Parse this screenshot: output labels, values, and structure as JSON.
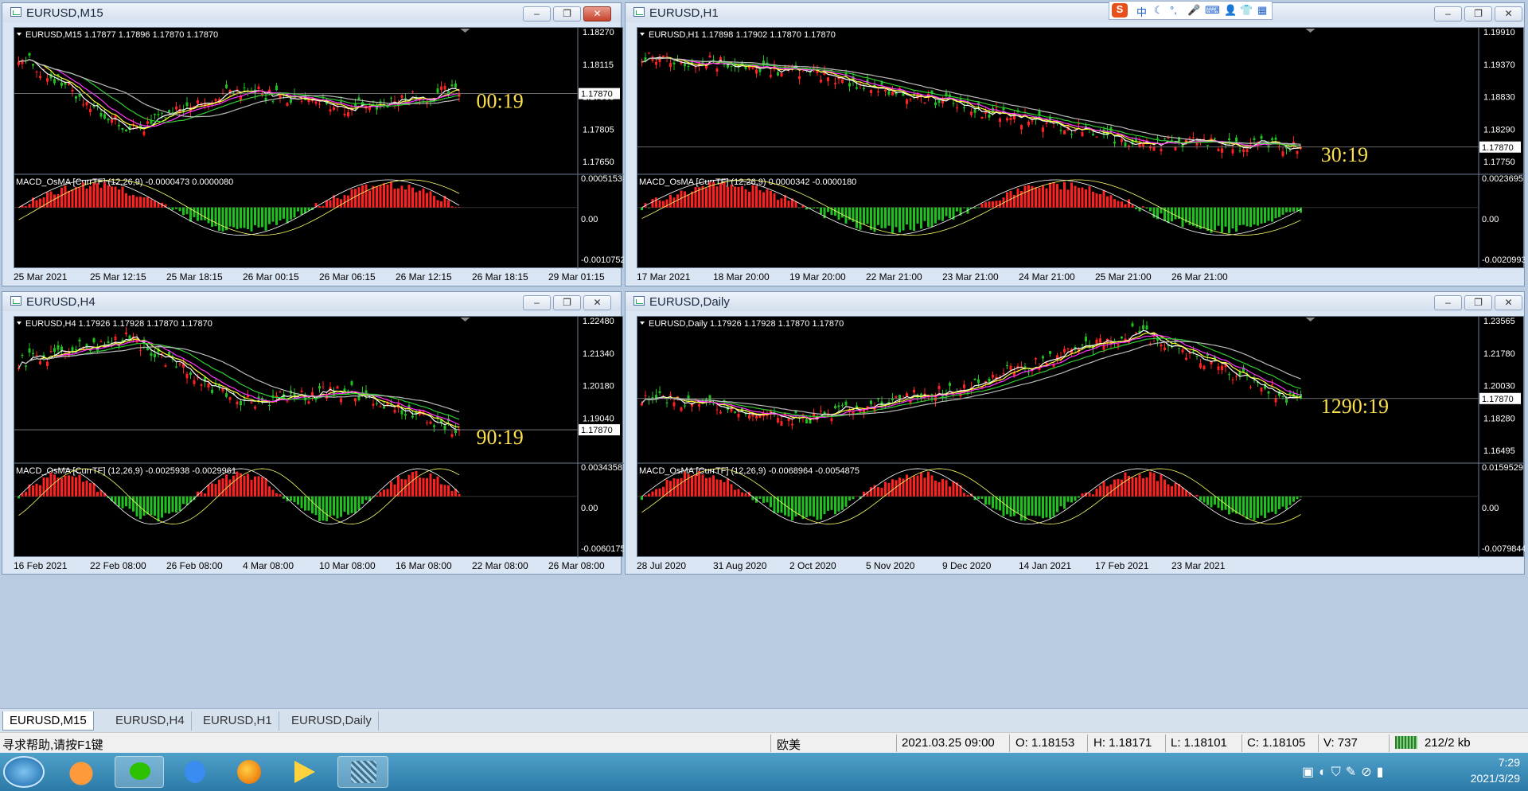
{
  "windows": [
    {
      "title": "EURUSD,M15",
      "header": "EURUSD,M15  1.17877 1.17896 1.17870 1.17870",
      "prices": [
        "1.18270",
        "1.18115",
        "1.17960",
        "1.17805",
        "1.17650"
      ],
      "current": "1.17870",
      "timer": "00:19",
      "macd": "MACD_OsMA [CurrTF] (12,26,9) -0.0000473 0.0000080",
      "macd_scale": [
        "0.0005153",
        "0.00",
        "-0.0010752"
      ],
      "xlabels": [
        "25 Mar 2021",
        "25 Mar 12:15",
        "25 Mar 18:15",
        "26 Mar 00:15",
        "26 Mar 06:15",
        "26 Mar 12:15",
        "26 Mar 18:15",
        "29 Mar 01:15"
      ]
    },
    {
      "title": "EURUSD,H1",
      "header": "EURUSD,H1  1.17898 1.17902 1.17870 1.17870",
      "prices": [
        "1.19910",
        "1.19370",
        "1.18830",
        "1.18290",
        "1.17750"
      ],
      "current": "1.17870",
      "timer": "30:19",
      "macd": "MACD_OsMA [CurrTF] (12,26,9) 0.0000342 -0.0000180",
      "macd_scale": [
        "0.0023695",
        "0.00",
        "-0.0020993"
      ],
      "xlabels": [
        "17 Mar 2021",
        "18 Mar 20:00",
        "19 Mar 20:00",
        "22 Mar 21:00",
        "23 Mar 21:00",
        "24 Mar 21:00",
        "25 Mar 21:00",
        "26 Mar 21:00"
      ]
    },
    {
      "title": "EURUSD,H4",
      "header": "EURUSD,H4  1.17926 1.17928 1.17870 1.17870",
      "prices": [
        "1.22480",
        "1.21340",
        "1.20180",
        "1.19040",
        ""
      ],
      "current": "1.17870",
      "timer": "90:19",
      "macd": "MACD_OsMA [CurrTF] (12,26,9) -0.0025938 -0.0029961",
      "macd_scale": [
        "0.0034358",
        "0.00",
        "-0.0060175"
      ],
      "xlabels": [
        "16 Feb 2021",
        "22 Feb 08:00",
        "26 Feb 08:00",
        "4 Mar 08:00",
        "10 Mar 08:00",
        "16 Mar 08:00",
        "22 Mar 08:00",
        "26 Mar 08:00"
      ]
    },
    {
      "title": "EURUSD,Daily",
      "header": "EURUSD,Daily  1.17926 1.17928 1.17870 1.17870",
      "prices": [
        "1.23565",
        "1.21780",
        "1.20030",
        "1.18280",
        "1.16495"
      ],
      "current": "1.17870",
      "timer": "1290:19",
      "macd": "MACD_OsMA [CurrTF] (12,26,9) -0.0068964 -0.0054875",
      "macd_scale": [
        "0.0159529",
        "0.00",
        "-0.0079844"
      ],
      "xlabels": [
        "28 Jul 2020",
        "31 Aug 2020",
        "2 Oct 2020",
        "5 Nov 2020",
        "9 Dec 2020",
        "14 Jan 2021",
        "17 Feb 2021",
        "23 Mar 2021"
      ]
    }
  ],
  "tabs": [
    "EURUSD,M15",
    "EURUSD,H4",
    "EURUSD,H1",
    "EURUSD,Daily"
  ],
  "status": {
    "help": "寻求帮助,请按F1键",
    "profile": "欧美",
    "datetime": "2021.03.25 09:00",
    "open": "O: 1.18153",
    "high": "H: 1.18171",
    "low": "L: 1.18101",
    "close": "C: 1.18105",
    "volume": "V: 737",
    "traffic": "212/2 kb"
  },
  "clock": {
    "time": "7:29",
    "date": "2021/3/29"
  },
  "ime": {
    "mode": "中"
  },
  "colors": {
    "bull": "#ff2020",
    "bear": "#20c020",
    "timer": "#ffe14d"
  }
}
